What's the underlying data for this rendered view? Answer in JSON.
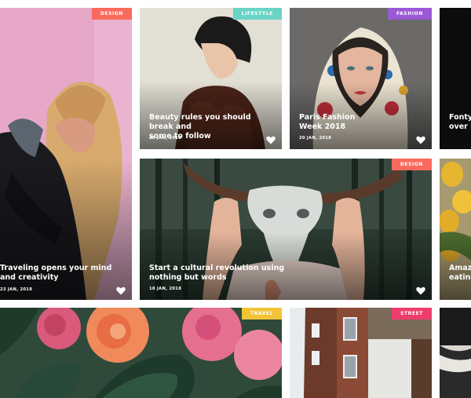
{
  "colors": {
    "design": "#f96a5d",
    "lifestyle": "#68d4c6",
    "fashion": "#9b59d6",
    "travel": "#f2c435",
    "street": "#ee3d6c"
  },
  "cards": [
    {
      "category": "DESIGN",
      "title_line1": "Traveling opens your mind",
      "title_line2": "and creativity",
      "date": "23 JAN, 2018",
      "icon": "heart-icon"
    },
    {
      "category": "LIFESTYLE",
      "title_line1": "Beauty rules you should break and",
      "title_line2": "some to follow",
      "date": "22 JAN, 2018",
      "icon": "heart-icon"
    },
    {
      "category": "FASHION",
      "title_line1": "Paris Fashion",
      "title_line2": "Week 2018",
      "date": "20 JAN, 2018",
      "icon": "heart-icon"
    },
    {
      "title_line1": "Fonty I",
      "title_line2": "over in",
      "icon": "heart-icon"
    },
    {
      "category": "DESIGN",
      "title_line1": "Start a cultural revolution using",
      "title_line2": "nothing but words",
      "date": "18 JAN, 2018",
      "icon": "heart-icon"
    },
    {
      "title_line1": "Amazi",
      "title_line2": "eating"
    },
    {
      "category": "TRAVEL"
    },
    {
      "category": "STREET"
    },
    {}
  ]
}
